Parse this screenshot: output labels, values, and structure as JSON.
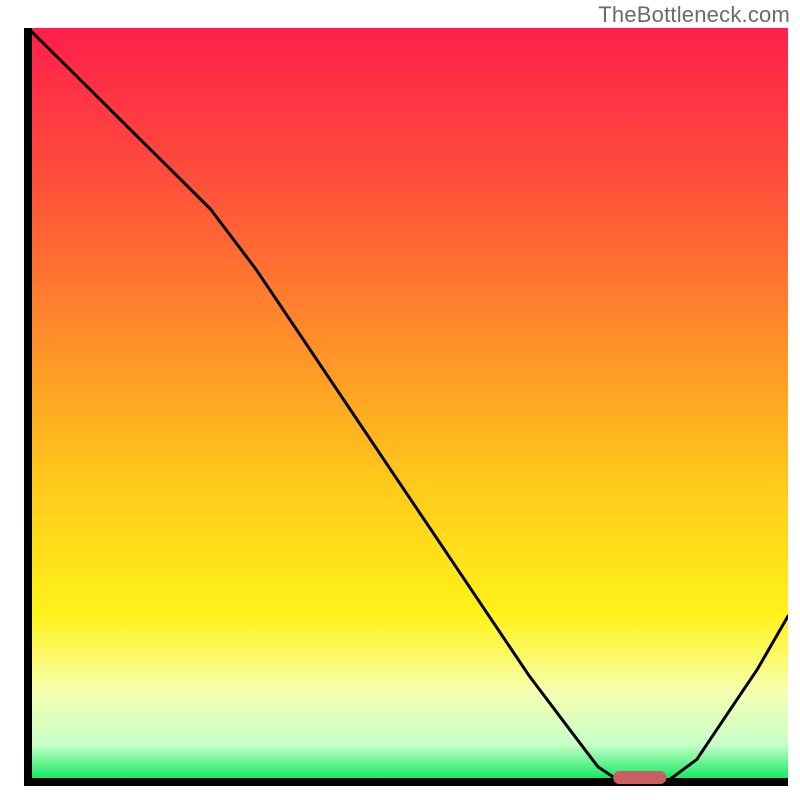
{
  "watermark": "TheBottleneck.com",
  "chart_data": {
    "type": "line",
    "title": "",
    "xlabel": "",
    "ylabel": "",
    "xlim": [
      0,
      100
    ],
    "ylim": [
      0,
      100
    ],
    "series": [
      {
        "name": "curve",
        "x": [
          0,
          6,
          12,
          18,
          24,
          30,
          36,
          42,
          48,
          54,
          60,
          66,
          72,
          75,
          78,
          81,
          84,
          88,
          92,
          96,
          100
        ],
        "y": [
          100,
          94,
          88,
          82,
          76,
          68,
          59,
          50,
          41,
          32,
          23,
          14,
          6,
          2,
          0,
          0,
          0,
          3,
          9,
          15,
          22
        ]
      }
    ],
    "marker": {
      "x_start": 77,
      "x_end": 84,
      "y": 0.6,
      "color": "#c9605f"
    },
    "gradient_stops": [
      {
        "offset": 0.0,
        "color": "#ff1f4b"
      },
      {
        "offset": 0.2,
        "color": "#ff4e3b"
      },
      {
        "offset": 0.4,
        "color": "#ff8a2a"
      },
      {
        "offset": 0.6,
        "color": "#ffc81b"
      },
      {
        "offset": 0.78,
        "color": "#fff31a"
      },
      {
        "offset": 0.88,
        "color": "#f7ffb0"
      },
      {
        "offset": 0.95,
        "color": "#c8ffc8"
      },
      {
        "offset": 1.0,
        "color": "#00e85a"
      }
    ],
    "axis_color": "#000000",
    "curve_color": "#000000",
    "curve_width": 3
  }
}
